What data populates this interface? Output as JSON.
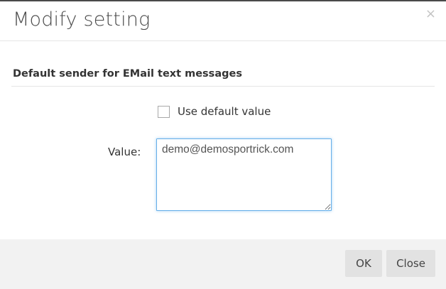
{
  "dialog": {
    "title": "Modify setting",
    "close_glyph": "×",
    "close_icon": "close-icon"
  },
  "setting": {
    "heading": "Default sender for EMail text messages",
    "use_default_label": "Use default value",
    "use_default_checked": false,
    "value_label": "Value:",
    "value": "demo@demosportrick.com"
  },
  "footer": {
    "ok_label": "OK",
    "close_label": "Close"
  },
  "colors": {
    "focus_border": "#66afe9",
    "footer_bg": "#f2f2f2",
    "button_bg": "#e2e2e2"
  }
}
